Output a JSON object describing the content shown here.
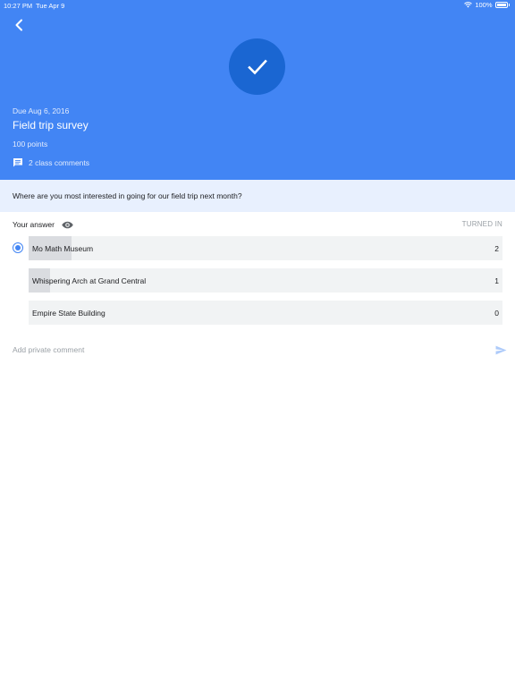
{
  "status_bar": {
    "time": "10:27 PM",
    "date": "Tue Apr 9",
    "battery": "100%",
    "wifi_icon": "wifi-icon",
    "battery_icon": "battery-icon"
  },
  "header": {
    "back_icon": "chevron-left-icon",
    "status_icon": "checkmark-icon",
    "due": "Due Aug 6, 2016",
    "title": "Field trip survey",
    "points": "100 points",
    "comments_icon": "comment-icon",
    "comments_label": "2 class comments"
  },
  "question": {
    "text": "Where are you most interested in going for our field trip next month?"
  },
  "answer": {
    "label": "Your answer",
    "eye_icon": "eye-icon",
    "status": "TURNED IN",
    "options": [
      {
        "label": "Mo Math Museum",
        "count": "2",
        "selected": true,
        "fill_fraction": 0.09
      },
      {
        "label": "Whispering Arch at Grand Central",
        "count": "1",
        "selected": false,
        "fill_fraction": 0.045
      },
      {
        "label": "Empire State Building",
        "count": "0",
        "selected": false,
        "fill_fraction": 0
      }
    ]
  },
  "private_comment": {
    "placeholder": "Add private comment",
    "send_icon": "send-icon"
  },
  "colors": {
    "header_bg": "#4285f4",
    "check_circle": "#1a66d2",
    "question_bg": "#e8f0fe",
    "option_bg": "#f1f3f4",
    "option_fill": "#dadce0",
    "accent": "#4285f4"
  }
}
